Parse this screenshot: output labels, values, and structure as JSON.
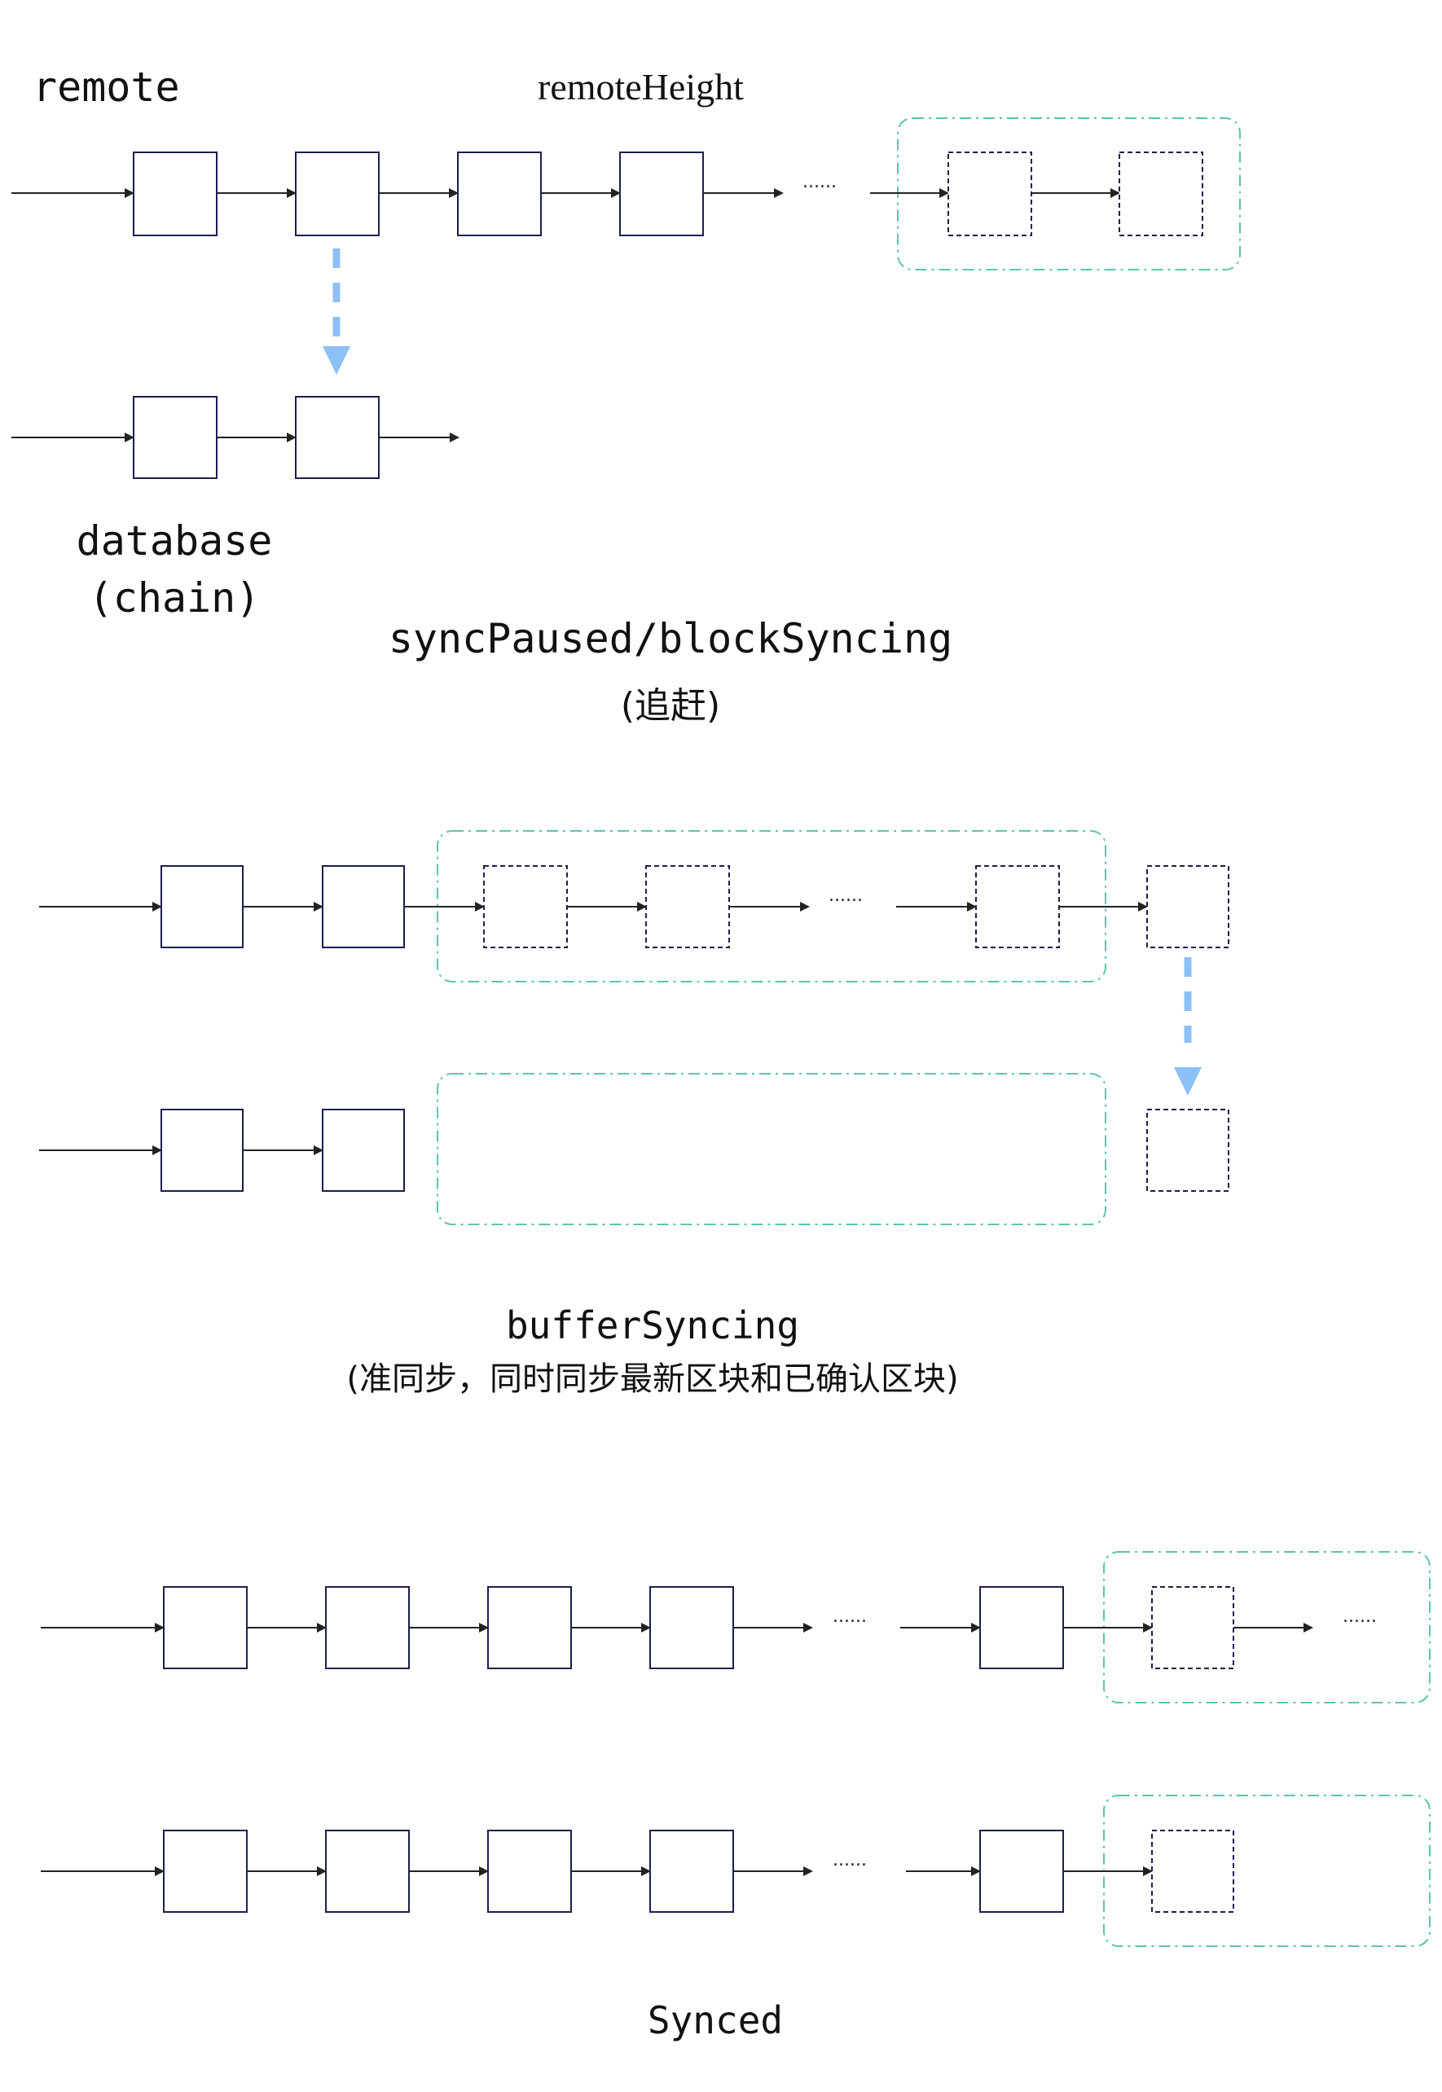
{
  "colors": {
    "block_stroke": "#1b1f4d",
    "line": "#222222",
    "range_box": "#5dc4b0",
    "sync_arrow": "#8cc0f7",
    "background": "#ffffff"
  },
  "labels": {
    "remote": "remote",
    "remote_height": "remoteHeight",
    "database": "database",
    "database_chain": "(chain)",
    "state1_title": "syncPaused/blockSyncing",
    "state1_subtitle": "(追赶)",
    "state2_title": "bufferSyncing",
    "state2_subtitle": "(准同步，同时同步最新区块和已确认区块)",
    "state3_title": "Synced",
    "ellipsis": "......"
  }
}
